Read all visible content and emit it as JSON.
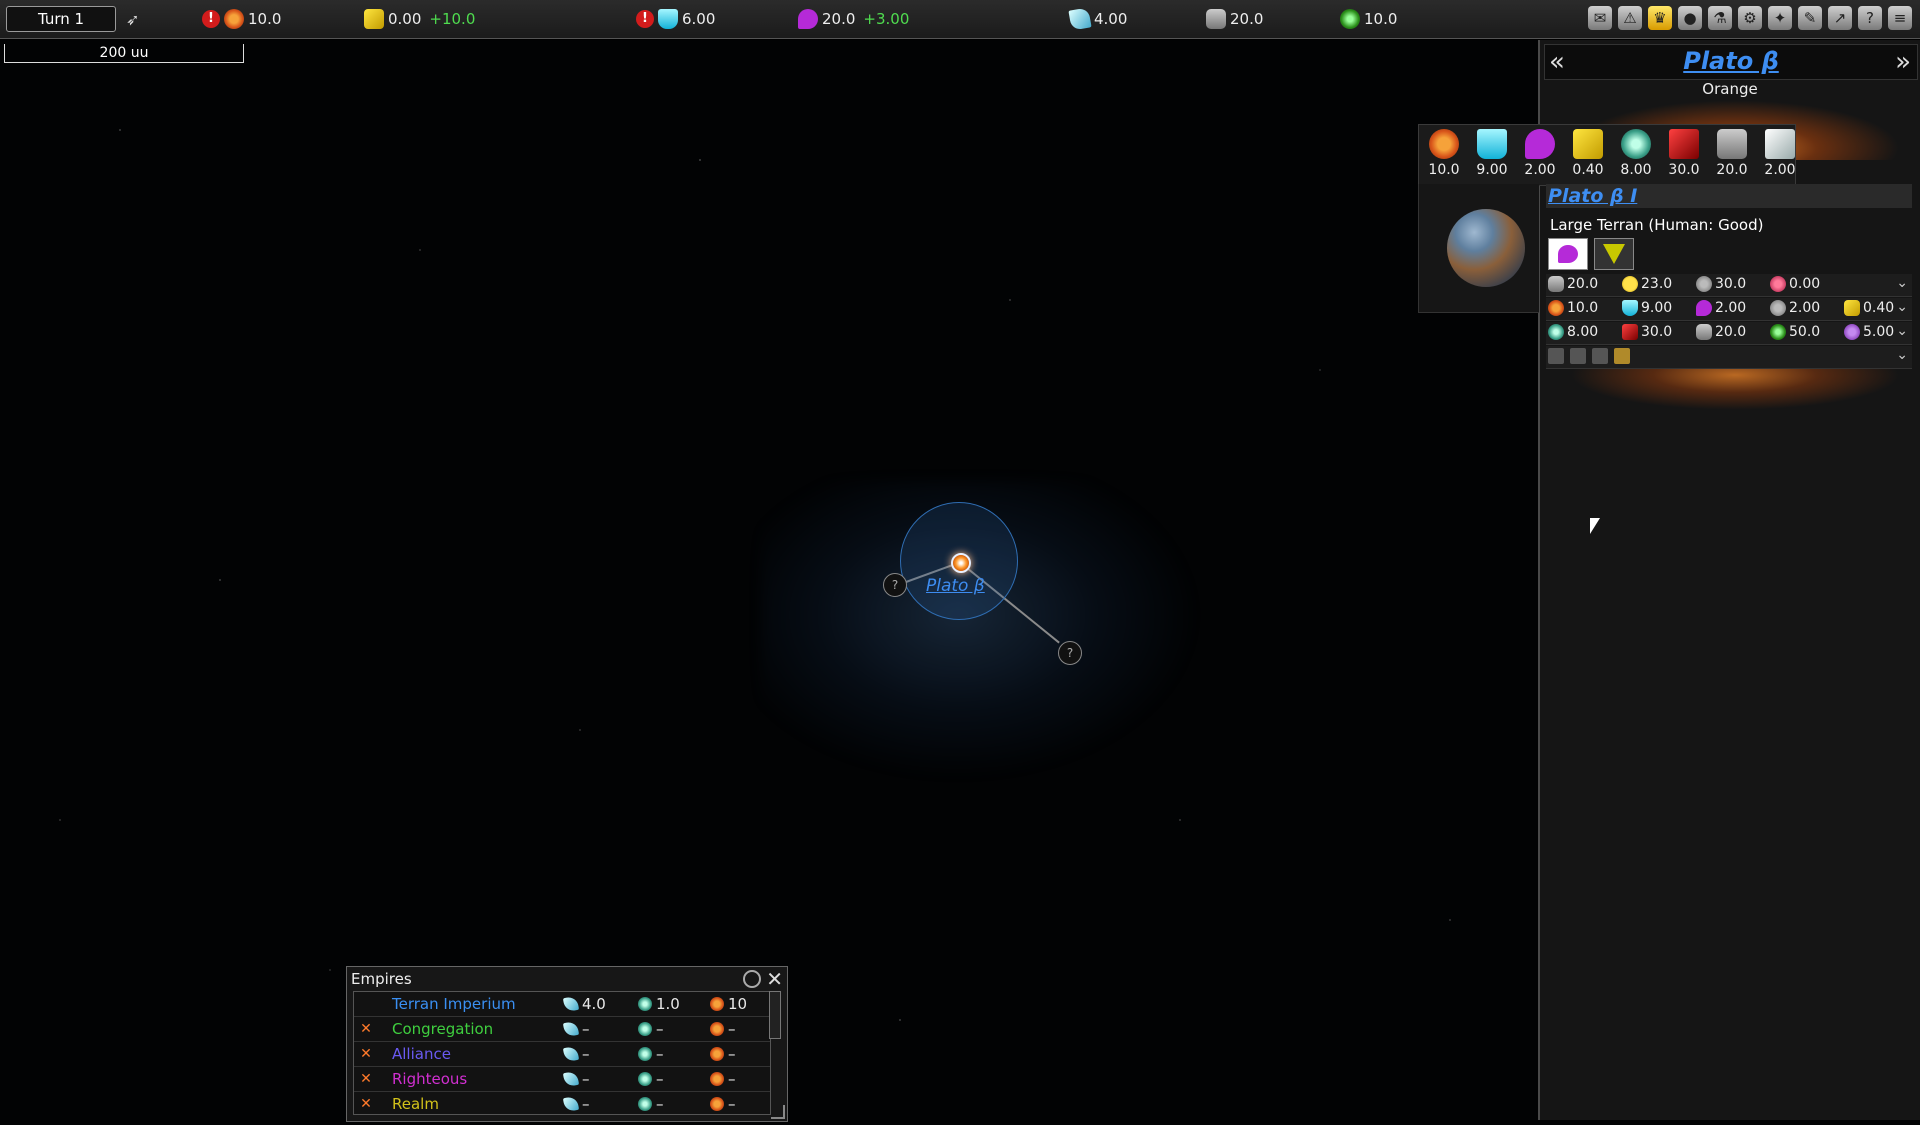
{
  "topbar": {
    "turn_label": "Turn 1",
    "industry": "10.0",
    "trade": "0.00",
    "trade_delta": "+10.0",
    "research": "6.00",
    "influence": "20.0",
    "influence_delta": "+3.00",
    "fleet": "4.00",
    "population": "20.0",
    "detection": "10.0",
    "menu_icons": [
      "messages-icon",
      "alert-icon",
      "empires-icon",
      "objects-icon",
      "research-icon",
      "production-icon",
      "government-icon",
      "design-icon",
      "graphs-icon",
      "help-icon",
      "menu-icon"
    ]
  },
  "map": {
    "scale_label": "200 uu",
    "system_name": "Plato β",
    "unknown_label": "?"
  },
  "right_panel": {
    "system_title": "Plato β",
    "star_color": "Orange",
    "resources": [
      {
        "icon": "industry-icon",
        "value": "10.0"
      },
      {
        "icon": "research-icon",
        "value": "9.00"
      },
      {
        "icon": "influence-icon",
        "value": "2.00"
      },
      {
        "icon": "trade-icon",
        "value": "0.40"
      },
      {
        "icon": "supply-icon",
        "value": "8.00"
      },
      {
        "icon": "defense-icon",
        "value": "30.0"
      },
      {
        "icon": "troops-icon",
        "value": "20.0"
      },
      {
        "icon": "stockpile-icon",
        "value": "2.00"
      }
    ],
    "planet": {
      "name": "Plato β I",
      "type": "Large Terran (Human: Good)",
      "row1": [
        "20.0",
        "23.0",
        "30.0",
        "0.00"
      ],
      "row2": [
        "10.0",
        "9.00",
        "2.00",
        "2.00",
        "0.40"
      ],
      "row3": [
        "8.00",
        "30.0",
        "20.0",
        "50.0",
        "5.00"
      ]
    }
  },
  "empires_window": {
    "title": "Empires",
    "rows": [
      {
        "name": "Terran Imperium",
        "color": "#3a8ff2",
        "at_war": false,
        "fleet": "4.0",
        "planets": "1.0",
        "industry": "10"
      },
      {
        "name": "Congregation",
        "color": "#3fcf3f",
        "at_war": true,
        "fleet": "–",
        "planets": "–",
        "industry": "–"
      },
      {
        "name": "Alliance",
        "color": "#6a5af2",
        "at_war": true,
        "fleet": "–",
        "planets": "–",
        "industry": "–"
      },
      {
        "name": "Righteous",
        "color": "#d12fd1",
        "at_war": true,
        "fleet": "–",
        "planets": "–",
        "industry": "–"
      },
      {
        "name": "Realm",
        "color": "#d2c21a",
        "at_war": true,
        "fleet": "–",
        "planets": "–",
        "industry": "–"
      }
    ]
  }
}
